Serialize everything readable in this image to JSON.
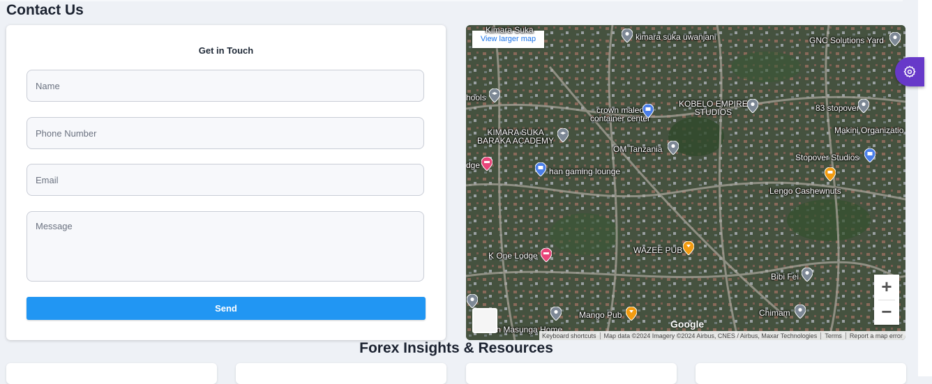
{
  "page": {
    "title": "Contact Us"
  },
  "form": {
    "heading": "Get in Touch",
    "name_placeholder": "Name",
    "phone_placeholder": "Phone Number",
    "email_placeholder": "Email",
    "message_placeholder": "Message",
    "send_label": "Send"
  },
  "map": {
    "view_larger_label": "View larger map",
    "places": [
      {
        "label": "Kimara Suka"
      },
      {
        "label": "kimara suka uwanjani"
      },
      {
        "label": "GNC Solutions Yard"
      },
      {
        "label": "hools"
      },
      {
        "label": "crown maleo\ncontainer center"
      },
      {
        "label": "KOBELO EMPIRE\nSTUDIOS"
      },
      {
        "label": "83 stopover"
      },
      {
        "label": "KIMARA SUKA\nBARAKA ACADEMY"
      },
      {
        "label": "Makini Organizatio"
      },
      {
        "label": "OM Tanzania"
      },
      {
        "label": "Stopover Studios"
      },
      {
        "label": "dge"
      },
      {
        "label": "han gaming lounge"
      },
      {
        "label": "Lengo Cashewnuts"
      },
      {
        "label": "WAZEE PUB"
      },
      {
        "label": "K One Lodge"
      },
      {
        "label": "Bibi Fei"
      },
      {
        "label": "Mango Pub"
      },
      {
        "label": "Chimam"
      },
      {
        "label": "th Masunga Home"
      }
    ],
    "zoom_in_label": "+",
    "zoom_out_label": "−",
    "google_logo": "Google",
    "footer": {
      "keyboard": "Keyboard shortcuts",
      "data": "Map data ©2024 Imagery ©2024 Airbus, CNES / Airbus, Maxar Technologies",
      "terms": "Terms",
      "report": "Report a map error"
    }
  },
  "resources": {
    "title": "Forex Insights & Resources"
  }
}
